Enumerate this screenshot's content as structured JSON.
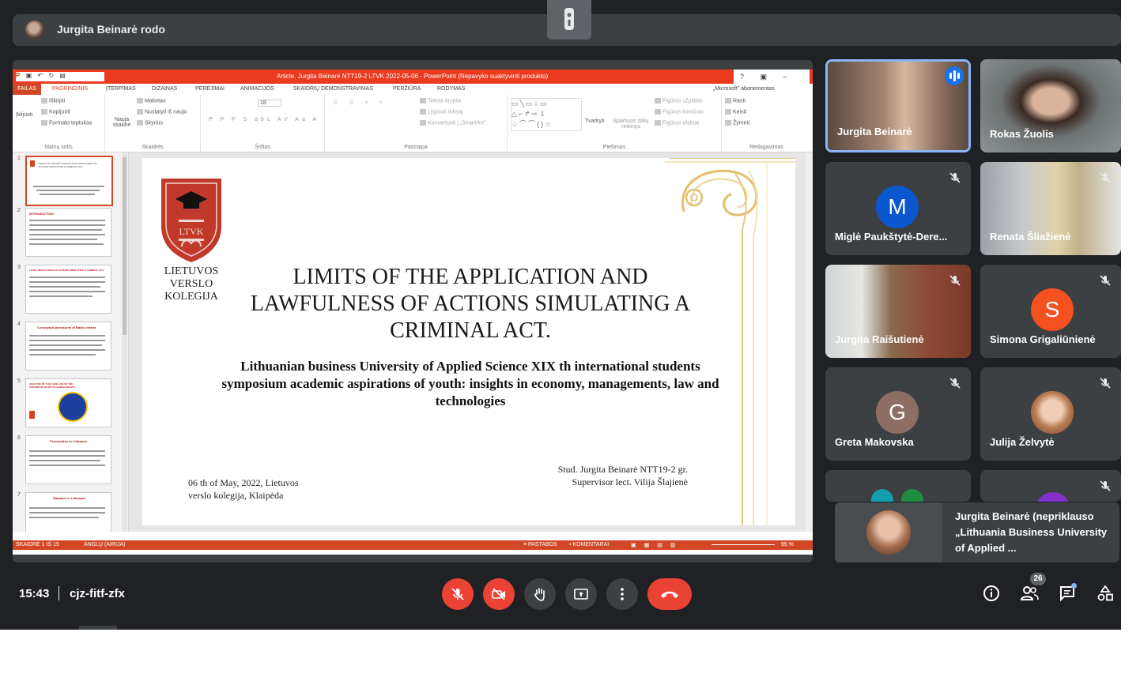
{
  "presenting_bar": {
    "label": "Jurgita Beinarė rodo"
  },
  "powerpoint": {
    "window_title": "Article. Jurgita Beinarė NTT19-2 LTVK 2022-05-06 - PowerPoint (Nepavyko suaktyvinti produkto)",
    "window_controls": "? ▣ – ▢ ✕",
    "account": "„Microsoft\" abonementas",
    "ribbon_tabs": [
      "FAILAS",
      "PAGRINDINIS",
      "ĮTERPIMAS",
      "DIZAINAS",
      "PERĖJIMAI",
      "ANIMACIJOS",
      "SKAIDRIŲ DEMONSTRAVIMAS",
      "PERŽIŪRA",
      "RODYMAS"
    ],
    "ribbon": {
      "clipboard": {
        "cut": "Iškirpti",
        "copy": "Kopijuoti",
        "format_painter": "Formato teptukas",
        "paste": "Įklijuoti",
        "group": "Mainų sritis"
      },
      "slides": {
        "layout": "Maketas",
        "reset": "Nustatyti iš naujo",
        "section": "Skyrius",
        "new_slide": "Nauja skaidrė",
        "group": "Skaidrės"
      },
      "font": {
        "size": "18",
        "group": "Šriftas"
      },
      "paragraph": {
        "text_direction": "Teksto kryptis",
        "align_text": "Lygiuoti tekstą",
        "smartart": "Konvertuoti į „SmartArt\"",
        "group": "Pastraipa"
      },
      "drawing": {
        "arrange": "Tvarkyti",
        "quick_styles": "Spartusis stilių rinkinys",
        "shape_fill": "Figūros užpildas",
        "shape_outline": "Figūros kontūras",
        "shape_effects": "Figūros efektai",
        "group": "Piešimas"
      },
      "editing": {
        "find": "Rasti",
        "replace": "Keisti",
        "select": "Žymėti",
        "group": "Redagavimas"
      }
    },
    "thumbnails": [
      {
        "num": "1",
        "title": "LIMITS OF THE APPLICATION AND LAWFULNESS OF ACTIONS SIMULATING A CRIMINAL ACT"
      },
      {
        "num": "2",
        "title": "INTRODUCTION"
      },
      {
        "num": "3",
        "title": "LEGAL REGULATION OF ACTIONS SIMULATING A CRIMINAL ACT"
      },
      {
        "num": "4",
        "title": "Conceptual provisions of Baltic criteria"
      },
      {
        "num": "5",
        "title": "ANALYSIS OF THE CASE LAW OF THE EUROPEAN COURT OF HUMAN RIGHTS"
      },
      {
        "num": "6",
        "title": "Provocation in Lithuania"
      },
      {
        "num": "7",
        "title": "Situation in Lithuania"
      }
    ],
    "slide": {
      "logo_letters": "LTVK",
      "college_name": "LIETUVOS VERSLO KOLEGIJA",
      "title": "LIMITS OF THE APPLICATION AND LAWFULNESS OF ACTIONS SIMULATING A CRIMINAL ACT.",
      "subtitle": "Lithuanian business University of Applied Science XIX th international students symposium academic aspirations of youth: insights in economy, managements, law and technologies",
      "date_place": "06 th of May, 2022, Lietuvos\nverslo kolegija, Klaipėda",
      "author": "Stud. Jurgita Beinarė NTT19-2 gr.\nSupervisor lect. Vilija Šlajienė"
    },
    "status": {
      "slide_counter": "SKAIDRĖ 1 IŠ 15",
      "language": "ANGLŲ (AIRIJA)",
      "notes": "PASTABOS",
      "comments": "KOMENTARAI",
      "zoom": "95 %"
    }
  },
  "participants": [
    {
      "name": "Jurgita Beinarė",
      "type": "video",
      "speaking": true,
      "muted": false
    },
    {
      "name": "Rokas Žuolis",
      "type": "video",
      "muted": false
    },
    {
      "name": "Miglė Paukštytė-Dere...",
      "type": "avatar",
      "initial": "M",
      "color": "#0b57d0",
      "muted": true
    },
    {
      "name": "Renata Šliažienė",
      "type": "video",
      "muted": true
    },
    {
      "name": "Jurgita Raišutienė",
      "type": "video",
      "muted": true
    },
    {
      "name": "Simona Grigaliūnienė",
      "type": "avatar",
      "initial": "S",
      "color": "#f4511e",
      "muted": true
    },
    {
      "name": "Greta Makovska",
      "type": "avatar",
      "initial": "G",
      "color": "#8d6e63",
      "muted": true
    },
    {
      "name": "Julija Želvytė",
      "type": "photo",
      "muted": true
    }
  ],
  "pip": {
    "label": "Jurgita Beinarė (nepriklauso „Lithuania Business University of Applied ..."
  },
  "controls": {
    "time": "15:43",
    "meeting_code": "cjz-fitf-zfx",
    "participant_count": "26"
  }
}
